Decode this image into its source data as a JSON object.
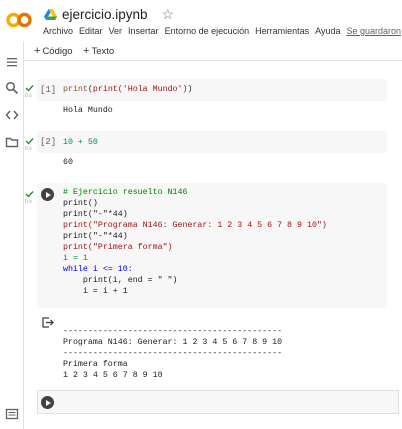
{
  "app": {
    "notebook_title": "ejercicio.ipynb",
    "menu": [
      "Archivo",
      "Editar",
      "Ver",
      "Insertar",
      "Entorno de ejecución",
      "Herramientas",
      "Ayuda"
    ],
    "saved_status": "Se guardaron"
  },
  "toolbar": {
    "code_label": "Código",
    "text_label": "Texto",
    "plus": "+"
  },
  "cells": [
    {
      "run_label": "[1]",
      "code": "print('Hola Mundo')",
      "output": "Hola Mundo",
      "sub": "0 s"
    },
    {
      "run_label": "[2]",
      "code": "10 + 50",
      "output": "60",
      "sub": "0 s"
    },
    {
      "sub": "0 s",
      "code_lines": [
        "# Ejercicio resuelto N146",
        "print()",
        "print(\"-\"*44)",
        "print(\"Programa N146: Generar: 1 2 3 4 5 6 7 8 9 10\")",
        "print(\"-\"*44)",
        "print(\"Primera forma\")",
        "i = 1",
        "while i <= 10:",
        "    print(i, end = \" \")",
        "    i = i + 1"
      ],
      "output_lines": [
        "",
        "--------------------------------------------",
        "Programa N146: Generar: 1 2 3 4 5 6 7 8 9 10",
        "--------------------------------------------",
        "Primera forma",
        "1 2 3 4 5 6 7 8 9 10"
      ]
    }
  ],
  "colors": {
    "logo_orange": "#F9AB00",
    "logo_dark_orange": "#E37400",
    "check_green": "#1e8e3e",
    "cell_bg": "#f7f7f7"
  },
  "icons": [
    "colab-logo-icon",
    "drive-icon",
    "star-icon",
    "menu-icon",
    "search-icon",
    "code-icon",
    "folder-icon",
    "terminal-icon",
    "run-icon",
    "output-icon",
    "check-icon"
  ]
}
